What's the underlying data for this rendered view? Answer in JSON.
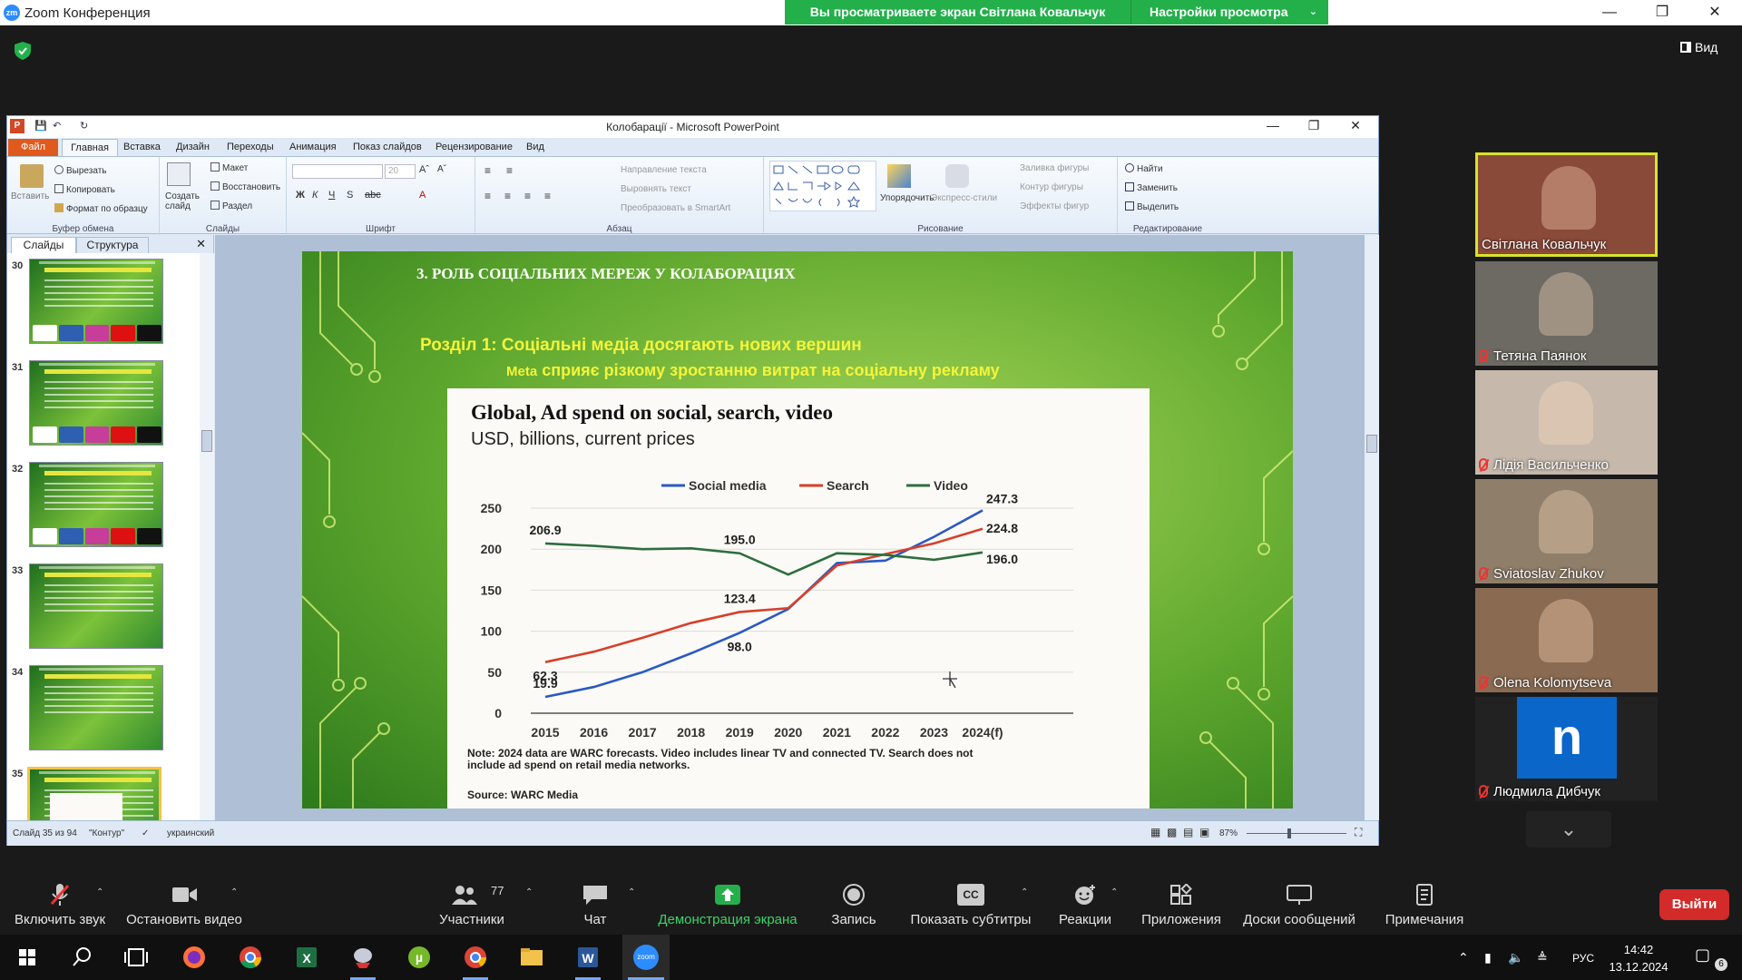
{
  "zoom": {
    "window_title": "Zoom Конференция",
    "logo_text": "zm",
    "share_banner": "Вы просматриваете экран Світлана Ковальчук",
    "view_options": "Настройки просмотра",
    "view_button": "Вид"
  },
  "ppt": {
    "title": "Колобарації - Microsoft PowerPoint",
    "app_icon_letter": "P",
    "tabs": [
      "Файл",
      "Главная",
      "Вставка",
      "Дизайн",
      "Переходы",
      "Анимация",
      "Показ слайдов",
      "Рецензирование",
      "Вид"
    ],
    "ribbon": {
      "clipboard": {
        "label": "Буфер обмена",
        "paste": "Вставить",
        "cut": "Вырезать",
        "copy": "Копировать",
        "format_painter": "Формат по образцу"
      },
      "slides": {
        "label": "Слайды",
        "new_slide": "Создать слайд",
        "layout": "Макет",
        "reset": "Восстановить",
        "section": "Раздел"
      },
      "font": {
        "label": "Шрифт",
        "size": "20"
      },
      "paragraph": {
        "label": "Абзац",
        "text_direction": "Направление текста",
        "align_text": "Выровнять текст",
        "smartart": "Преобразовать в SmartArt"
      },
      "drawing": {
        "label": "Рисование",
        "arrange": "Упорядочить",
        "quick_styles": "Экспресс-стили",
        "shape_fill": "Заливка фигуры",
        "shape_outline": "Контур фигуры",
        "shape_effects": "Эффекты фигур"
      },
      "editing": {
        "label": "Редактирование",
        "find": "Найти",
        "replace": "Заменить",
        "select": "Выделить"
      }
    },
    "panel_tabs": {
      "slides": "Слайды",
      "outline": "Структура"
    },
    "thumbnails": [
      "30",
      "31",
      "32",
      "33",
      "34",
      "35"
    ],
    "status": {
      "slide": "Слайд 35 из 94",
      "theme": "\"Контур\"",
      "language": "украинский",
      "zoom": "87%"
    }
  },
  "slide": {
    "heading": "3. РОЛЬ СОЦІАЛЬНИХ МЕРЕЖ У КОЛАБОРАЦІЯХ",
    "section": "Розділ 1: Соціальні медіа досягають нових вершин",
    "subtitle_meta": "Meta",
    "subtitle_rest": " сприяє різкому зростанню витрат на соціальну рекламу"
  },
  "chart_data": {
    "type": "line",
    "title": "Global, Ad spend on social, search, video",
    "subtitle": "USD, billions, current prices",
    "x": [
      "2015",
      "2016",
      "2017",
      "2018",
      "2019",
      "2020",
      "2021",
      "2022",
      "2023",
      "2024(f)"
    ],
    "ylim": [
      0,
      250
    ],
    "yticks": [
      0,
      50,
      100,
      150,
      200,
      250
    ],
    "grid": true,
    "legend_position": "top",
    "series": [
      {
        "name": "Social media",
        "color": "#2b59c3",
        "values": [
          19.9,
          32,
          50,
          73,
          98.0,
          127,
          183,
          186,
          215,
          247.3
        ]
      },
      {
        "name": "Search",
        "color": "#d6402c",
        "values": [
          62.3,
          75,
          92,
          110,
          123.4,
          128,
          180,
          194,
          207,
          224.8
        ]
      },
      {
        "name": "Video",
        "color": "#2e6e3e",
        "values": [
          206.9,
          204,
          200,
          201,
          195.0,
          169,
          195,
          193,
          187,
          196.0
        ]
      }
    ],
    "data_labels": [
      {
        "series": 2,
        "index": 0,
        "text": "206.9",
        "pos": "above"
      },
      {
        "series": 2,
        "index": 4,
        "text": "195.0",
        "pos": "above"
      },
      {
        "series": 1,
        "index": 0,
        "text": "62.3",
        "pos": "below"
      },
      {
        "series": 1,
        "index": 4,
        "text": "123.4",
        "pos": "above"
      },
      {
        "series": 0,
        "index": 0,
        "text": "19.9",
        "pos": "above"
      },
      {
        "series": 0,
        "index": 4,
        "text": "98.0",
        "pos": "below"
      },
      {
        "series": 0,
        "index": 9,
        "text": "247.3",
        "pos": "end-above"
      },
      {
        "series": 1,
        "index": 9,
        "text": "224.8",
        "pos": "end"
      },
      {
        "series": 2,
        "index": 9,
        "text": "196.0",
        "pos": "end-below"
      }
    ],
    "note": "Note: 2024 data are WARC forecasts. Video includes linear TV and connected TV. Search does not include ad spend on retail media networks.",
    "source": "Source: WARC Media"
  },
  "participants": [
    {
      "name": "Світлана Ковальчук",
      "muted": false,
      "bg": "#8a4a3a",
      "active": true
    },
    {
      "name": "Тетяна Паянок",
      "muted": true,
      "bg": "#6d6a63"
    },
    {
      "name": "Лідія Васильченко",
      "muted": true,
      "bg": "#c6b9ac"
    },
    {
      "name": "Sviatoslav Zhukov",
      "muted": true,
      "bg": "#8f7f6a"
    },
    {
      "name": "Olena Kolomytseva",
      "muted": true,
      "bg": "#8a6b52"
    },
    {
      "name": "Людмила Дибчук",
      "muted": true,
      "bg": "#222222",
      "avatar_letter": "n"
    }
  ],
  "toolbar": {
    "unmute": "Включить звук",
    "stop_video": "Остановить видео",
    "participants": "Участники",
    "participants_count": "77",
    "chat": "Чат",
    "share_screen": "Демонстрация экрана",
    "record": "Запись",
    "captions": "Показать субтитры",
    "captions_icon_text": "CC",
    "reactions": "Реакции",
    "apps": "Приложения",
    "whiteboards": "Доски сообщений",
    "notes": "Примечания",
    "leave": "Выйти"
  },
  "taskbar": {
    "language": "РУС",
    "time": "14:42",
    "date": "13.12.2024",
    "notifications": "6",
    "zoom_icon_text": "zoom"
  }
}
